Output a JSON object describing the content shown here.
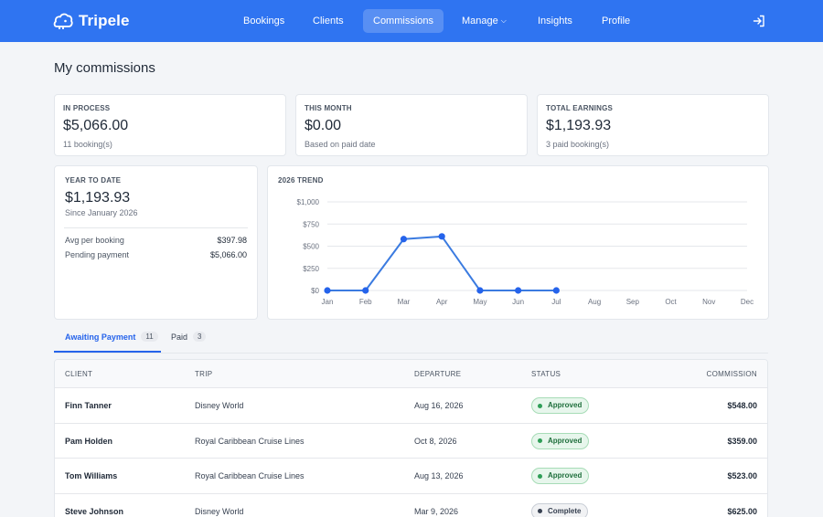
{
  "app": {
    "name": "Tripele"
  },
  "nav": {
    "items": [
      {
        "label": "Bookings"
      },
      {
        "label": "Clients"
      },
      {
        "label": "Commissions",
        "active": true
      },
      {
        "label": "Manage"
      },
      {
        "label": "Insights"
      },
      {
        "label": "Profile"
      }
    ],
    "logout_icon": "logout-icon"
  },
  "page": {
    "title": "My commissions"
  },
  "cards": {
    "in_process": {
      "label": "IN PROCESS",
      "value": "$5,066.00",
      "sub": "11 booking(s)"
    },
    "this_month": {
      "label": "THIS MONTH",
      "value": "$0.00",
      "sub": "Based on paid date"
    },
    "total_earnings": {
      "label": "TOTAL EARNINGS",
      "value": "$1,193.93",
      "sub": "3 paid booking(s)"
    }
  },
  "ytd": {
    "label": "YEAR TO DATE",
    "value": "$1,193.93",
    "sub": "Since January 2026",
    "rows": [
      {
        "label": "Avg per booking",
        "value": "$397.98"
      },
      {
        "label": "Pending payment",
        "value": "$5,066.00"
      }
    ]
  },
  "chart_data": {
    "type": "line",
    "title": "2026 TREND",
    "categories": [
      "Jan",
      "Feb",
      "Mar",
      "Apr",
      "May",
      "Jun",
      "Jul",
      "Aug",
      "Sep",
      "Oct",
      "Nov",
      "Dec"
    ],
    "series": [
      {
        "values": [
          0,
          0,
          580,
          610,
          0,
          0,
          0
        ]
      }
    ],
    "yticks": [
      "$0",
      "$250",
      "$500",
      "$750",
      "$1,000"
    ],
    "ylim": [
      0,
      1000
    ],
    "grid": true,
    "color": "#3b7be0"
  },
  "tabs": [
    {
      "label": "Awaiting Payment",
      "count": "11",
      "active": true
    },
    {
      "label": "Paid",
      "count": "3"
    }
  ],
  "table": {
    "headers": {
      "client": "CLIENT",
      "trip": "TRIP",
      "departure": "DEPARTURE",
      "status": "STATUS",
      "commission": "COMMISSION"
    },
    "rows": [
      {
        "client": "Finn Tanner",
        "trip": "Disney World",
        "departure": "Aug 16, 2026",
        "status": "Approved",
        "commission": "$548.00"
      },
      {
        "client": "Pam Holden",
        "trip": "Royal Caribbean Cruise Lines",
        "departure": "Oct 8, 2026",
        "status": "Approved",
        "commission": "$359.00"
      },
      {
        "client": "Tom Williams",
        "trip": "Royal Caribbean Cruise Lines",
        "departure": "Aug 13, 2026",
        "status": "Approved",
        "commission": "$523.00"
      },
      {
        "client": "Steve Johnson",
        "trip": "Disney World",
        "departure": "Mar 9, 2026",
        "status": "Complete",
        "commission": "$625.00"
      }
    ]
  },
  "colors": {
    "brand": "#2f74f1",
    "approved_bg": "#e7f6ec",
    "approved_border": "#a7dcb7",
    "approved_dot": "#2f9e57",
    "approved_text": "#1f6f3c",
    "complete_bg": "#f1f2f4",
    "complete_border": "#c9ced6",
    "complete_dot": "#374151",
    "complete_text": "#374151"
  }
}
